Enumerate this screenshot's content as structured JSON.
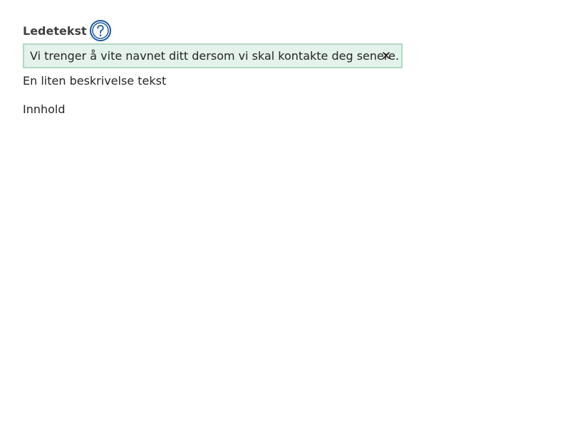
{
  "field": {
    "label": "Ledetekst",
    "help_icon": "question-circle-icon",
    "help_text": "Vi trenger å vite navnet ditt dersom vi skal kontakte deg senere.",
    "close_icon": "close-icon",
    "description": "En liten beskrivelse tekst",
    "content": "Innhold"
  },
  "colors": {
    "label": "#404040",
    "help_icon": "#1e5a9a",
    "help_panel_bg": "#e3f2ea",
    "help_panel_border": "#b1d8c2",
    "text": "#262626"
  }
}
